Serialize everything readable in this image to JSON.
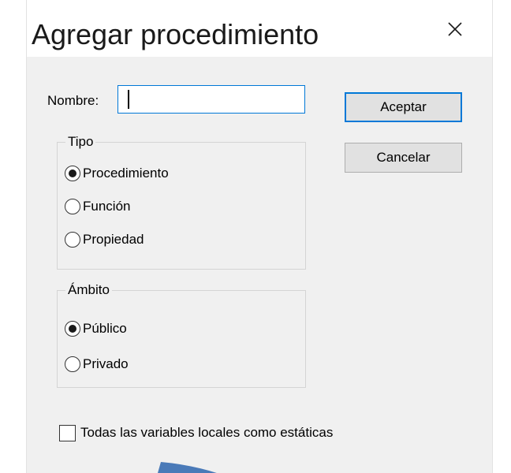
{
  "dialog": {
    "title": "Agregar procedimiento",
    "close_icon": "close-icon"
  },
  "name_field": {
    "label": "Nombre:",
    "value": "",
    "placeholder": ""
  },
  "buttons": {
    "accept_label": "Aceptar",
    "cancel_label": "Cancelar"
  },
  "type_group": {
    "title": "Tipo",
    "options": [
      {
        "label": "Procedimiento",
        "selected": true
      },
      {
        "label": "Función",
        "selected": false
      },
      {
        "label": "Propiedad",
        "selected": false
      }
    ]
  },
  "scope_group": {
    "title": "Ámbito",
    "options": [
      {
        "label": "Público",
        "selected": true
      },
      {
        "label": "Privado",
        "selected": false
      }
    ]
  },
  "static_checkbox": {
    "label": "Todas las variables locales como estáticas",
    "checked": false
  },
  "colors": {
    "dialog_bg": "#f0f0f0",
    "accent": "#0078d7",
    "arrow_annotation": "#4a7ab8"
  }
}
